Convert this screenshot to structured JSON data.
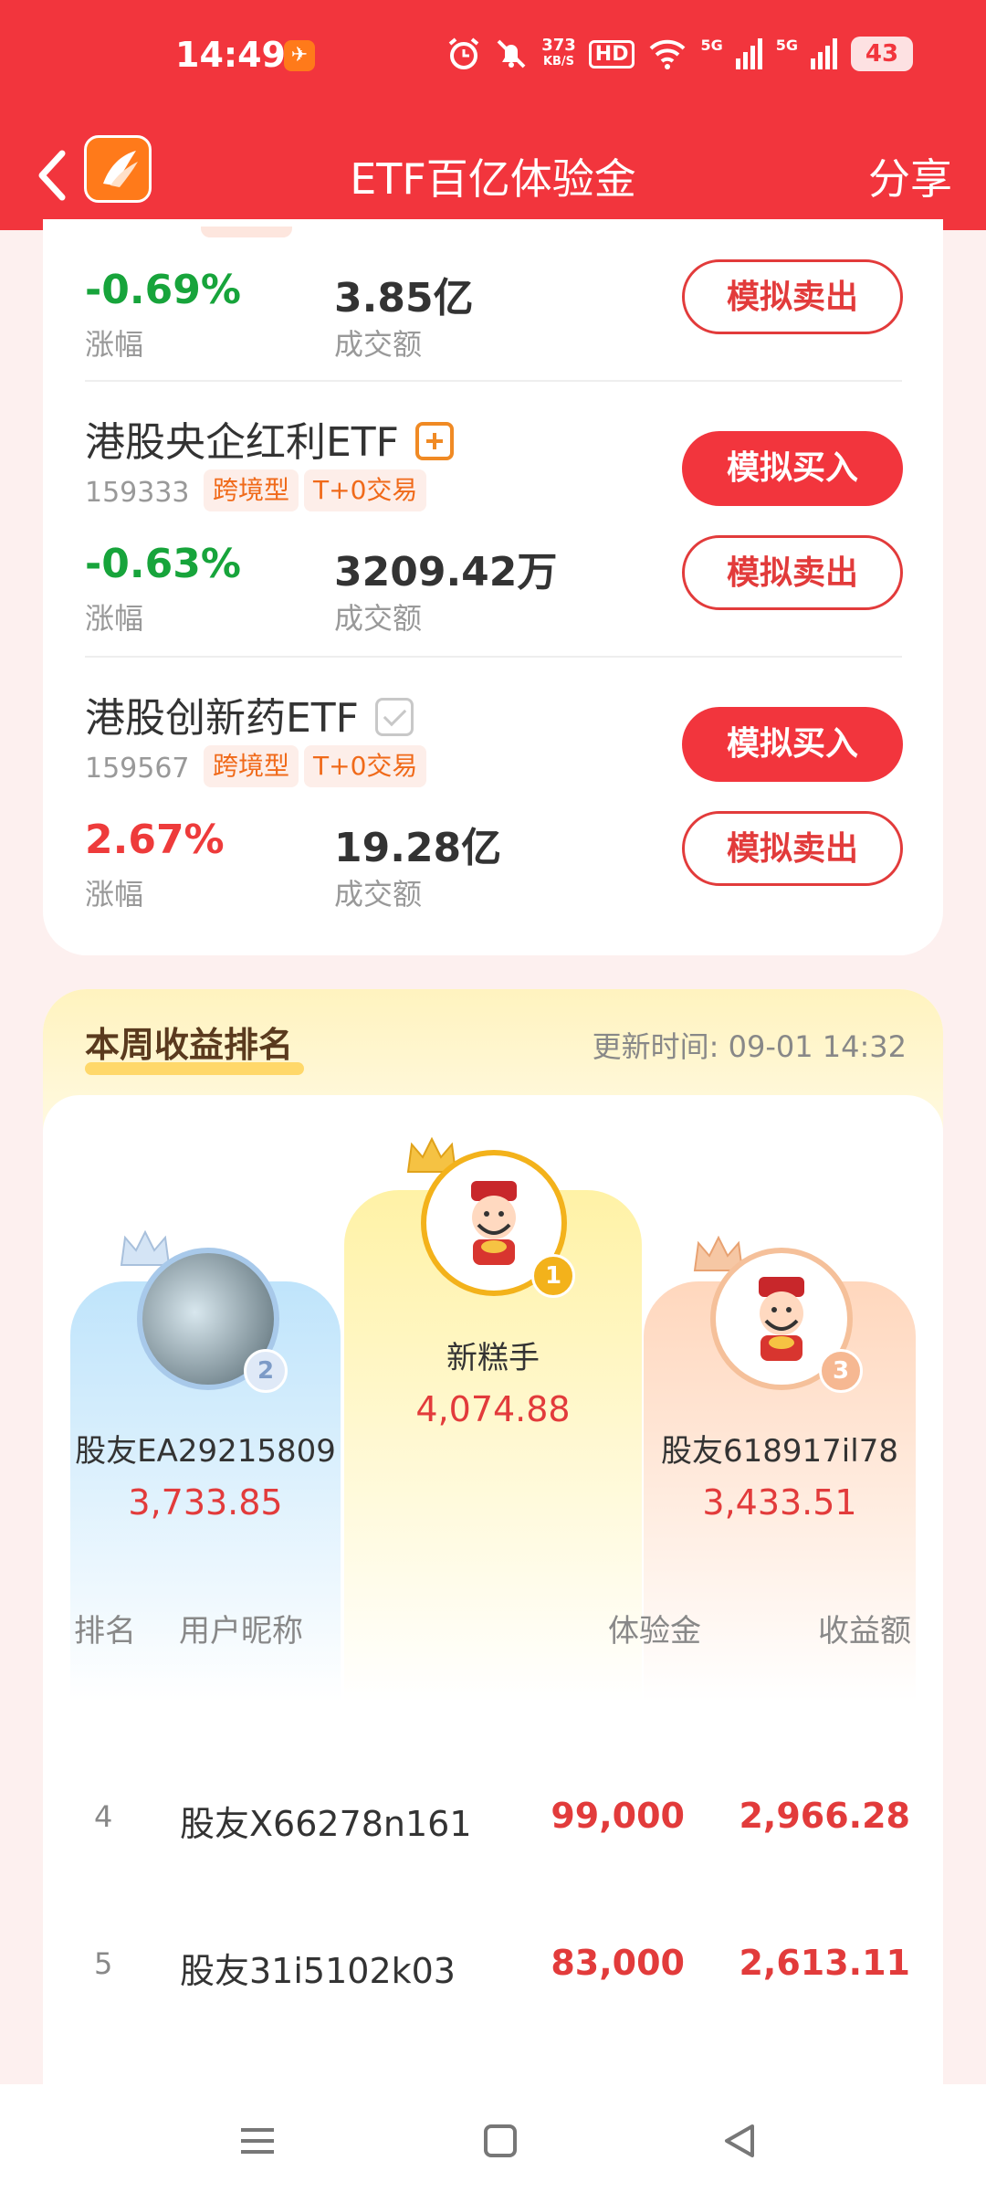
{
  "status_bar": {
    "time": "14:49",
    "net_speed_top": "373",
    "net_speed_unit": "KB/S",
    "hd": "HD",
    "signal1": "5G",
    "signal2": "5G",
    "battery": "43"
  },
  "header": {
    "title": "ETF百亿体验金",
    "share_label": "分享"
  },
  "etf_list": [
    {
      "change": "-0.69%",
      "change_label": "涨幅",
      "amount": "3.85亿",
      "amount_label": "成交额",
      "sell_label": "模拟卖出"
    },
    {
      "name": "港股央企红利ETF",
      "code": "159333",
      "tags": [
        "跨境型",
        "T+0交易"
      ],
      "change": "-0.63%",
      "change_label": "涨幅",
      "amount": "3209.42万",
      "amount_label": "成交额",
      "buy_label": "模拟买入",
      "sell_label": "模拟卖出"
    },
    {
      "name": "港股创新药ETF",
      "code": "159567",
      "tags": [
        "跨境型",
        "T+0交易"
      ],
      "change": "2.67%",
      "change_label": "涨幅",
      "amount": "19.28亿",
      "amount_label": "成交额",
      "buy_label": "模拟买入",
      "sell_label": "模拟卖出"
    }
  ],
  "ranking": {
    "title": "本周收益排名",
    "update_time": "更新时间: 09-01 14:32",
    "podium": [
      {
        "rank": "1",
        "name": "新糕手",
        "score": "4,074.88"
      },
      {
        "rank": "2",
        "name": "股友EA29215809",
        "score": "3,733.85"
      },
      {
        "rank": "3",
        "name": "股友618917il78",
        "score": "3,433.51"
      }
    ],
    "columns": {
      "rank": "排名",
      "nickname": "用户昵称",
      "experience": "体验金",
      "earnings": "收益额"
    },
    "rows": [
      {
        "rank": "4",
        "nickname": "股友X66278n161",
        "experience": "99,000",
        "earnings": "2,966.28"
      },
      {
        "rank": "5",
        "nickname": "股友31i5102k03",
        "experience": "83,000",
        "earnings": "2,613.11"
      }
    ]
  }
}
